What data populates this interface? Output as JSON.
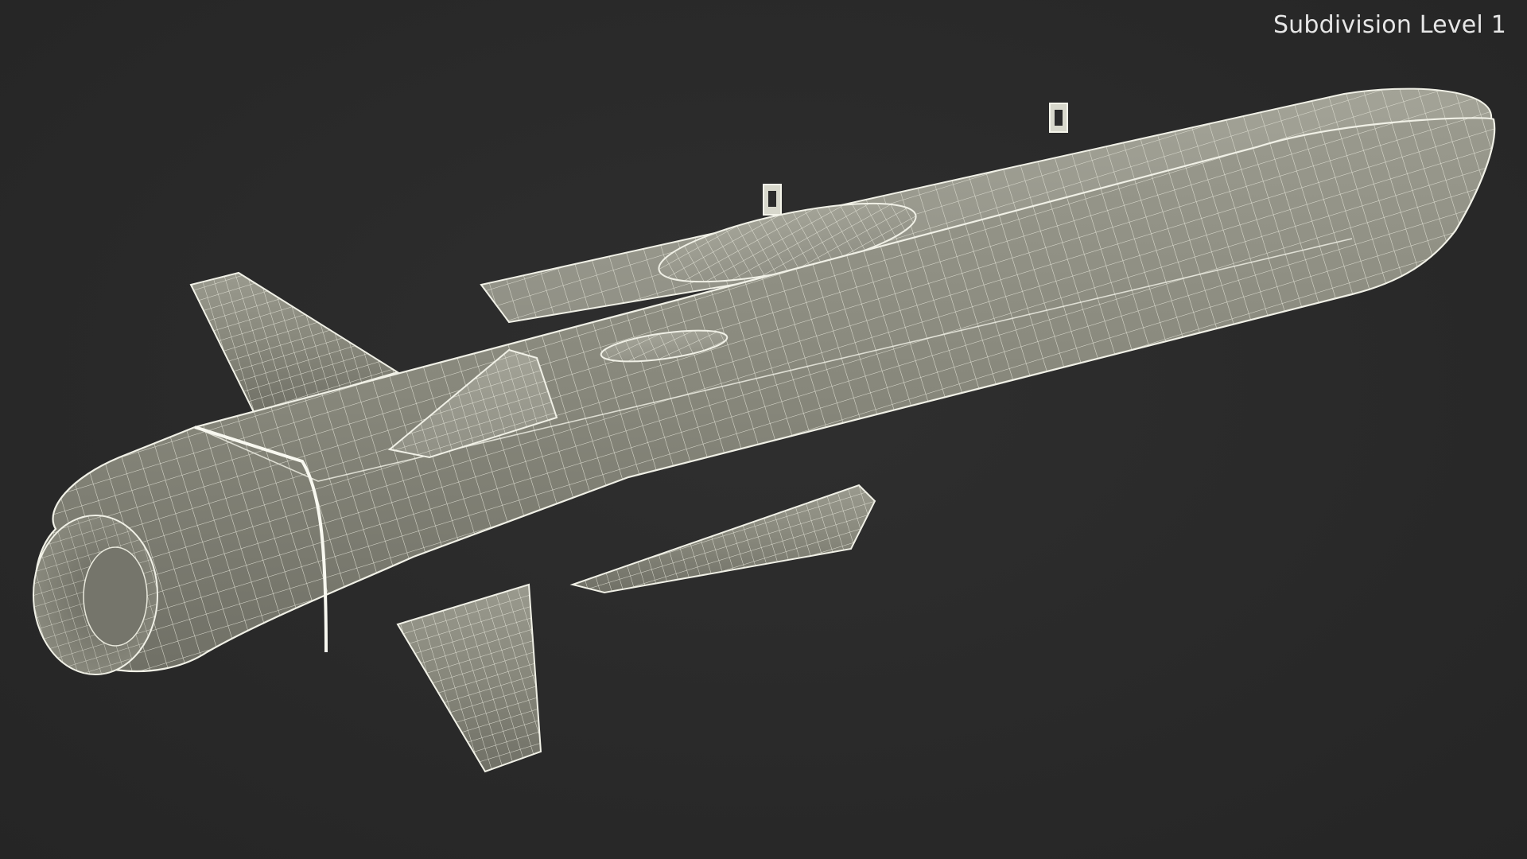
{
  "viewport": {
    "label": "Subdivision Level 1",
    "background_color": "#2b2b2b"
  },
  "model": {
    "shading": "wireframe-on-shaded",
    "surface_color": "#8a8a7e",
    "wire_color": "#e8e8dc"
  }
}
